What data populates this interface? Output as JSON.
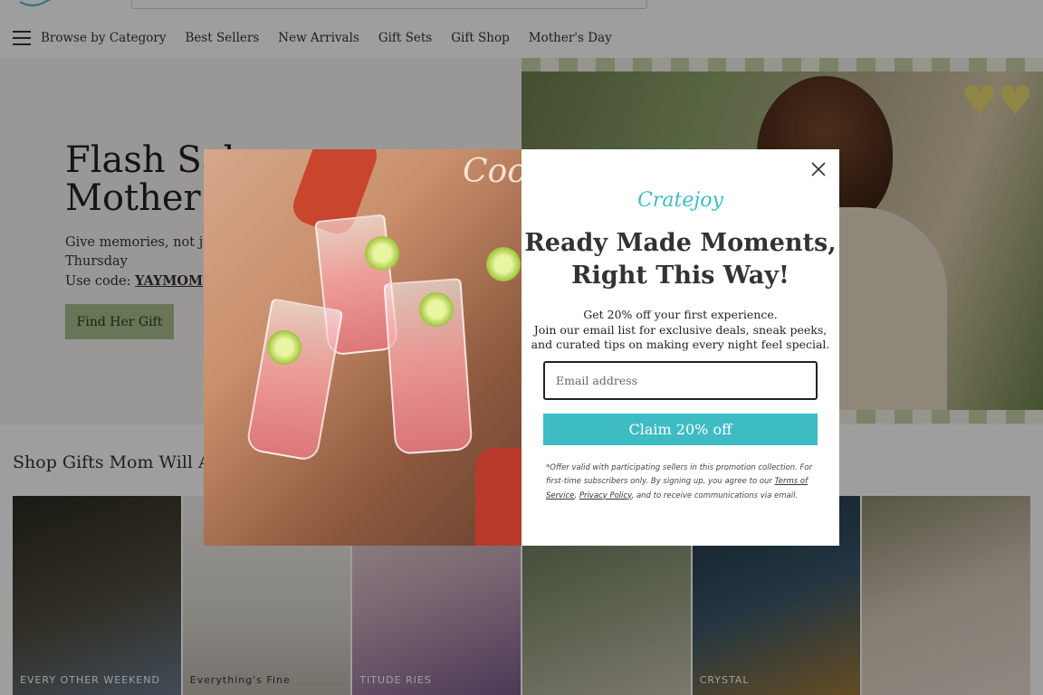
{
  "nav": {
    "items": [
      "Browse by Category",
      "Best Sellers",
      "New Arrivals",
      "Gift Sets",
      "Gift Shop",
      "Mother's Day"
    ]
  },
  "hero": {
    "title_line1": "Flash Sale",
    "title_line2": "Mother's",
    "text_line1": "Give memories, not jus",
    "text_line2": "Thursday",
    "code_label": "Use code: ",
    "code_value": "YAYMOM",
    "button": "Find Her Gift"
  },
  "shop": {
    "title": "Shop Gifts Mom Will Abso",
    "products": [
      {
        "caption": "EVERY OTHER WEEKEND",
        "color": "#3a3a2e"
      },
      {
        "caption": "Everything's Fine",
        "color": "#d8d6d0"
      },
      {
        "caption": "TITUDE RIES",
        "color": "#8d6f95"
      },
      {
        "caption": "",
        "color": "#7d8a6a"
      },
      {
        "caption": "CRYSTAL",
        "color": "#2c4a5c"
      },
      {
        "caption": "",
        "color": "#c9b8a6"
      }
    ]
  },
  "modal": {
    "brand": "Cratejoy",
    "title_line1": "Ready Made Moments,",
    "title_line2": "Right This Way!",
    "desc_line1": "Get 20% off your first experience.",
    "desc_line2": "Join our email list for exclusive deals, sneak peeks,",
    "desc_line3": "and curated tips on making every night feel special.",
    "email_placeholder": "Email address",
    "claim_button": "Claim 20% off",
    "fine_print_1": "*Offer valid with participating sellers in this promotion collection. For first-time subscribers only. By signing up, you agree to our ",
    "terms_link": "Terms of Service",
    "comma": ", ",
    "privacy_link": "Privacy Policy",
    "fine_print_2": ", and to receive communications via email.",
    "photo_box_text": "Coc"
  },
  "colors": {
    "accent_teal": "#3ebcc4",
    "hero_button": "#a9bd8c"
  }
}
